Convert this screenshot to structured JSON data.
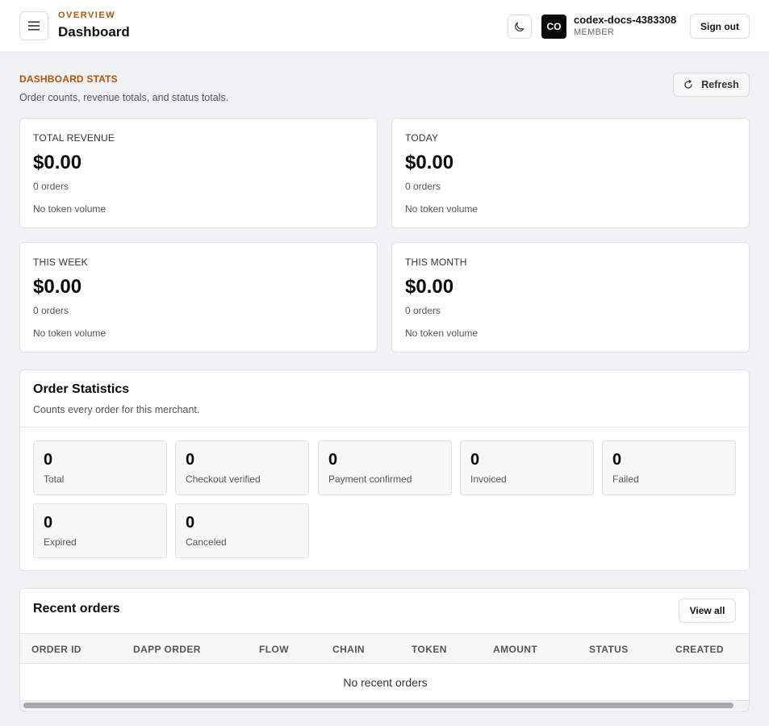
{
  "header": {
    "eyebrow": "OVERVIEW",
    "title": "Dashboard",
    "user": {
      "initials": "CO",
      "name": "codex-docs-4383308",
      "role": "MEMBER"
    },
    "sign_out_label": "Sign out"
  },
  "stats_section": {
    "eyebrow": "DASHBOARD STATS",
    "description": "Order counts, revenue totals, and status totals.",
    "refresh_label": "Refresh",
    "cards": [
      {
        "label": "TOTAL REVENUE",
        "value": "$0.00",
        "orders": "0 orders",
        "volume": "No token volume"
      },
      {
        "label": "TODAY",
        "value": "$0.00",
        "orders": "0 orders",
        "volume": "No token volume"
      },
      {
        "label": "THIS WEEK",
        "value": "$0.00",
        "orders": "0 orders",
        "volume": "No token volume"
      },
      {
        "label": "THIS MONTH",
        "value": "$0.00",
        "orders": "0 orders",
        "volume": "No token volume"
      }
    ]
  },
  "order_statistics": {
    "title": "Order Statistics",
    "description": "Counts every order for this merchant.",
    "counts": [
      {
        "value": "0",
        "label": "Total"
      },
      {
        "value": "0",
        "label": "Checkout verified"
      },
      {
        "value": "0",
        "label": "Payment confirmed"
      },
      {
        "value": "0",
        "label": "Invoiced"
      },
      {
        "value": "0",
        "label": "Failed"
      },
      {
        "value": "0",
        "label": "Expired"
      },
      {
        "value": "0",
        "label": "Canceled"
      }
    ]
  },
  "recent_orders": {
    "title": "Recent orders",
    "view_all_label": "View all",
    "columns": [
      "ORDER ID",
      "DAPP ORDER",
      "FLOW",
      "CHAIN",
      "TOKEN",
      "AMOUNT",
      "STATUS",
      "CREATED"
    ],
    "empty_text": "No recent orders"
  },
  "colors": {
    "accent": "#b45309",
    "background": "#f1f2f4",
    "card": "#ffffff",
    "avatar": "#0a0a0a"
  },
  "icons": {
    "menu": "menu-icon",
    "theme": "moon-icon",
    "refresh": "refresh-icon"
  }
}
